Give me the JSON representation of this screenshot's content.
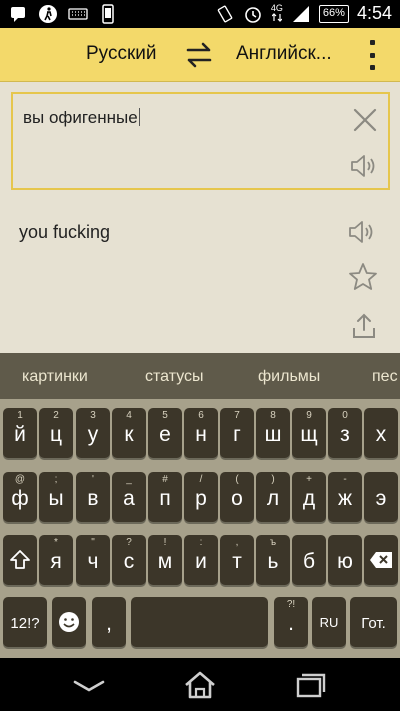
{
  "status_bar": {
    "network": "4G",
    "battery": "66%",
    "time": "4:54",
    "icons": [
      "notification-icon",
      "walker-icon",
      "keyboard-icon",
      "phone-icon",
      "vibrate-icon",
      "alarm-icon",
      "signal-icon"
    ]
  },
  "toolbar": {
    "source_lang": "Русский",
    "target_lang": "Английск...",
    "swap_icon": "swap-arrows-icon",
    "menu_icon": "overflow-menu-icon"
  },
  "translator": {
    "input_text": "вы офигенные",
    "output_text": "you fucking"
  },
  "suggestions": [
    "картинки",
    "статусы",
    "фильмы",
    "пес"
  ],
  "keyboard": {
    "row1": [
      {
        "k": "й",
        "h": "1"
      },
      {
        "k": "ц",
        "h": "2"
      },
      {
        "k": "у",
        "h": "3"
      },
      {
        "k": "к",
        "h": "4"
      },
      {
        "k": "е",
        "h": "5"
      },
      {
        "k": "н",
        "h": "6"
      },
      {
        "k": "г",
        "h": "7"
      },
      {
        "k": "ш",
        "h": "8"
      },
      {
        "k": "щ",
        "h": "9"
      },
      {
        "k": "з",
        "h": "0"
      },
      {
        "k": "х",
        "h": ""
      }
    ],
    "row2": [
      {
        "k": "ф",
        "h": "@"
      },
      {
        "k": "ы",
        "h": ";"
      },
      {
        "k": "в",
        "h": "'"
      },
      {
        "k": "а",
        "h": "_"
      },
      {
        "k": "п",
        "h": "#"
      },
      {
        "k": "р",
        "h": "/"
      },
      {
        "k": "о",
        "h": "("
      },
      {
        "k": "л",
        "h": ")"
      },
      {
        "k": "д",
        "h": "+"
      },
      {
        "k": "ж",
        "h": "-"
      },
      {
        "k": "э",
        "h": ""
      }
    ],
    "row3": [
      {
        "k": "я",
        "h": "*"
      },
      {
        "k": "ч",
        "h": "\""
      },
      {
        "k": "с",
        "h": "?"
      },
      {
        "k": "м",
        "h": "!"
      },
      {
        "k": "и",
        "h": ":"
      },
      {
        "k": "т",
        "h": ","
      },
      {
        "k": "ь",
        "h": "ъ"
      },
      {
        "k": "б",
        "h": ""
      },
      {
        "k": "ю",
        "h": ""
      }
    ],
    "symbols_label": "12!?",
    "comma_label": ",",
    "period_label": ".",
    "period_hint": "?!",
    "lang_label": "RU",
    "done_label": "Гот."
  },
  "colors": {
    "toolbar": "#f3d96a",
    "accent_border": "#e6c64c",
    "content_bg": "#e6e1d2",
    "key_bg": "#3c3629",
    "keyboard_bg": "#a7a18b",
    "suggest_bg": "#5f5a4a"
  }
}
